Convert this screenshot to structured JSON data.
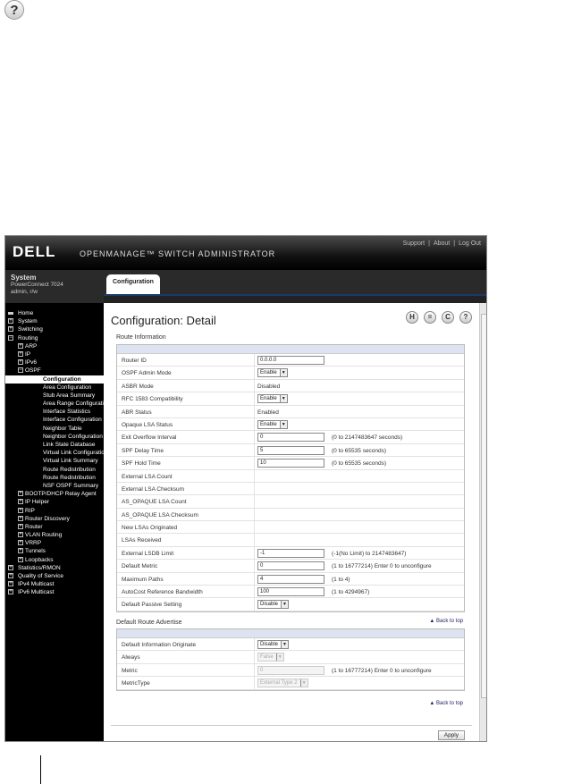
{
  "help_icon_top": "?",
  "banner": {
    "logo": "DELL",
    "product": "OPENMANAGE™ SWITCH ADMINISTRATOR",
    "links": [
      "Support",
      "About",
      "Log Out"
    ],
    "separator": "|"
  },
  "system": {
    "title": "System",
    "device": "PowerConnect 7024",
    "user": "admin, r/w"
  },
  "tab": {
    "label": "Configuration"
  },
  "nav": [
    {
      "label": "Home",
      "level": 0,
      "box": ""
    },
    {
      "label": "System",
      "level": 0,
      "box": "+"
    },
    {
      "label": "Switching",
      "level": 0,
      "box": "+"
    },
    {
      "label": "Routing",
      "level": 0,
      "box": "−"
    },
    {
      "label": "ARP",
      "level": 1,
      "box": "+"
    },
    {
      "label": "IP",
      "level": 1,
      "box": "+"
    },
    {
      "label": "IPv6",
      "level": 1,
      "box": "+"
    },
    {
      "label": "OSPF",
      "level": 1,
      "box": "−"
    },
    {
      "label": "Configuration",
      "level": 2,
      "box": "",
      "selected": true
    },
    {
      "label": "Area Configuration",
      "level": 2,
      "box": ""
    },
    {
      "label": "Stub Area Summary",
      "level": 2,
      "box": ""
    },
    {
      "label": "Area Range Configuration",
      "level": 2,
      "box": ""
    },
    {
      "label": "Interface Statistics",
      "level": 2,
      "box": ""
    },
    {
      "label": "Interface Configuration",
      "level": 2,
      "box": ""
    },
    {
      "label": "Neighbor Table",
      "level": 2,
      "box": ""
    },
    {
      "label": "Neighbor Configuration",
      "level": 2,
      "box": ""
    },
    {
      "label": "Link State Database",
      "level": 2,
      "box": ""
    },
    {
      "label": "Virtual Link Configuration",
      "level": 2,
      "box": ""
    },
    {
      "label": "Virtual Link Summary",
      "level": 2,
      "box": ""
    },
    {
      "label": "Route Redistribution",
      "level": 2,
      "box": ""
    },
    {
      "label": "Route Redistribution",
      "level": 2,
      "box": ""
    },
    {
      "label": "NSF OSPF Summary",
      "level": 2,
      "box": ""
    },
    {
      "label": "BOOTP/DHCP Relay Agent",
      "level": 1,
      "box": "+"
    },
    {
      "label": "IP Helper",
      "level": 1,
      "box": "+"
    },
    {
      "label": "RIP",
      "level": 1,
      "box": "+"
    },
    {
      "label": "Router Discovery",
      "level": 1,
      "box": "+"
    },
    {
      "label": "Router",
      "level": 1,
      "box": "+"
    },
    {
      "label": "VLAN Routing",
      "level": 1,
      "box": "+"
    },
    {
      "label": "VRRP",
      "level": 1,
      "box": "+"
    },
    {
      "label": "Tunnels",
      "level": 1,
      "box": "+"
    },
    {
      "label": "Loopbacks",
      "level": 1,
      "box": "+"
    },
    {
      "label": "Statistics/RMON",
      "level": 0,
      "box": "+"
    },
    {
      "label": "Quality of Service",
      "level": 0,
      "box": "+"
    },
    {
      "label": "IPv4 Multicast",
      "level": 0,
      "box": "+"
    },
    {
      "label": "IPv6 Multicast",
      "level": 0,
      "box": "+"
    }
  ],
  "page": {
    "title": "Configuration: Detail",
    "icons": [
      "save-icon",
      "print-icon",
      "refresh-icon",
      "help-icon"
    ],
    "icon_glyphs": [
      "H",
      "=",
      "C",
      "?"
    ]
  },
  "route_info": {
    "title": "Route Information",
    "rows": [
      {
        "label": "Router ID",
        "type": "input",
        "value": "0.0.0.0",
        "hint": ""
      },
      {
        "label": "OSPF Admin Mode",
        "type": "select",
        "value": "Enable",
        "hint": ""
      },
      {
        "label": "ASBR Mode",
        "type": "text",
        "value": "Disabled",
        "hint": ""
      },
      {
        "label": "RFC 1583 Compatibility",
        "type": "select",
        "value": "Enable",
        "hint": ""
      },
      {
        "label": "ABR Status",
        "type": "text",
        "value": "Enabled",
        "hint": ""
      },
      {
        "label": "Opaque LSA Status",
        "type": "select",
        "value": "Enable",
        "hint": ""
      },
      {
        "label": "Exit Overflow Interval",
        "type": "input",
        "value": "0",
        "hint": "(0 to 2147483647 seconds)"
      },
      {
        "label": "SPF Delay Time",
        "type": "input",
        "value": "5",
        "hint": "(0 to 65535 seconds)"
      },
      {
        "label": "SPF Hold Time",
        "type": "input",
        "value": "10",
        "hint": "(0 to 65535 seconds)"
      },
      {
        "label": "External LSA Count",
        "type": "text",
        "value": "",
        "hint": ""
      },
      {
        "label": "External LSA Checksum",
        "type": "text",
        "value": "",
        "hint": ""
      },
      {
        "label": "AS_OPAQUE LSA Count",
        "type": "text",
        "value": "",
        "hint": ""
      },
      {
        "label": "AS_OPAQUE LSA Checksum",
        "type": "text",
        "value": "",
        "hint": ""
      },
      {
        "label": "New LSAs Originated",
        "type": "text",
        "value": "",
        "hint": ""
      },
      {
        "label": "LSAs Received",
        "type": "text",
        "value": "",
        "hint": ""
      },
      {
        "label": "External LSDB Limit",
        "type": "input",
        "value": "-1",
        "hint": "(-1(No Limit) to 2147483647)"
      },
      {
        "label": "Default Metric",
        "type": "input",
        "value": "0",
        "hint": "(1 to 16777214) Enter 0 to unconfigure"
      },
      {
        "label": "Maximum Paths",
        "type": "input",
        "value": "4",
        "hint": "(1 to 4)"
      },
      {
        "label": "AutoCost Reference Bandwidth",
        "type": "input",
        "value": "100",
        "hint": "(1 to 4294967)"
      },
      {
        "label": "Default Passive Setting",
        "type": "select",
        "value": "Disable",
        "hint": ""
      }
    ]
  },
  "default_route": {
    "title": "Default Route Advertise",
    "back_to_top": "▲ Back to top",
    "rows": [
      {
        "label": "Default Information Originate",
        "type": "select",
        "value": "Disable",
        "hint": ""
      },
      {
        "label": "Always",
        "type": "select-dis",
        "value": "False",
        "hint": ""
      },
      {
        "label": "Metric",
        "type": "input-dis",
        "value": "0",
        "hint": "(1 to 16777214) Enter 0 to unconfigure"
      },
      {
        "label": "MetricType",
        "type": "select-dis",
        "value": "External Type 2",
        "hint": ""
      }
    ]
  },
  "back_to_top_2": "▲ Back to top",
  "apply_label": "Apply"
}
